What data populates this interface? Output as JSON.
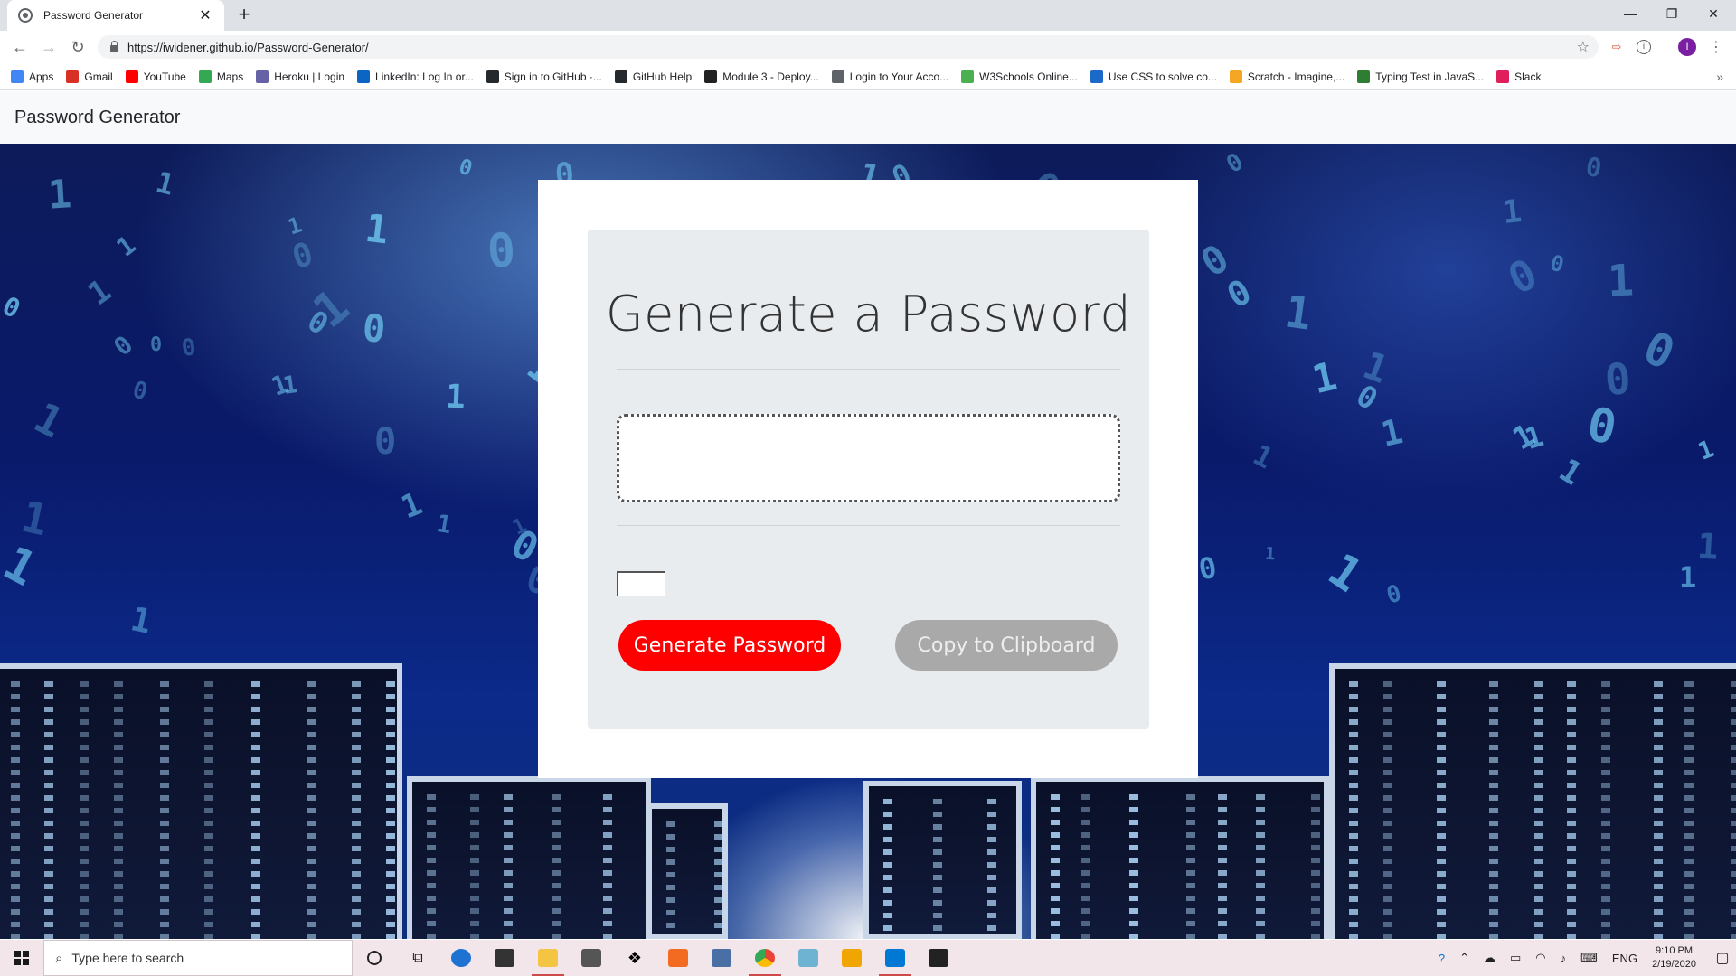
{
  "browser": {
    "tab_title": "Password Generator",
    "tab_close": "✕",
    "new_tab": "+",
    "url": "https://iwidener.github.io/Password-Generator/",
    "profile_initial": "I",
    "window_controls": {
      "minimize": "—",
      "restore": "❐",
      "close": "✕"
    },
    "bookmarks": [
      {
        "label": "Apps",
        "icon": "apps-grid-icon",
        "color": "#4285f4"
      },
      {
        "label": "Gmail",
        "icon": "gmail-icon",
        "color": "#d93025"
      },
      {
        "label": "YouTube",
        "icon": "youtube-icon",
        "color": "#ff0000"
      },
      {
        "label": "Maps",
        "icon": "maps-icon",
        "color": "#34a853"
      },
      {
        "label": "Heroku | Login",
        "icon": "heroku-icon",
        "color": "#6762a6"
      },
      {
        "label": "LinkedIn: Log In or...",
        "icon": "linkedin-icon",
        "color": "#0a66c2"
      },
      {
        "label": "Sign in to GitHub ·...",
        "icon": "github-icon",
        "color": "#24292e"
      },
      {
        "label": "GitHub Help",
        "icon": "github-icon",
        "color": "#24292e"
      },
      {
        "label": "Module 3 - Deploy...",
        "icon": "book-icon",
        "color": "#222222"
      },
      {
        "label": "Login to Your Acco...",
        "icon": "globe-icon",
        "color": "#5f6368"
      },
      {
        "label": "W3Schools Online...",
        "icon": "w3schools-icon",
        "color": "#4caf50"
      },
      {
        "label": "Use CSS to solve co...",
        "icon": "css-icon",
        "color": "#1b6ac9"
      },
      {
        "label": "Scratch - Imagine,...",
        "icon": "scratch-icon",
        "color": "#f5a623"
      },
      {
        "label": "Typing Test in JavaS...",
        "icon": "typing-icon",
        "color": "#2e7d32"
      },
      {
        "label": "Slack",
        "icon": "slack-icon",
        "color": "#e01e5a"
      }
    ],
    "bookmarks_more": "»"
  },
  "page": {
    "brand": "Password Generator",
    "card_title": "Generate a Password",
    "password_value": "",
    "length_value": "",
    "generate_label": "Generate Password",
    "copy_label": "Copy to Clipboard",
    "colors": {
      "generate_button": "#ff0000",
      "copy_button": "#a9a9a9"
    }
  },
  "taskbar": {
    "search_placeholder": "Type here to search",
    "language": "ENG",
    "time": "9:10 PM",
    "date": "2/19/2020"
  }
}
